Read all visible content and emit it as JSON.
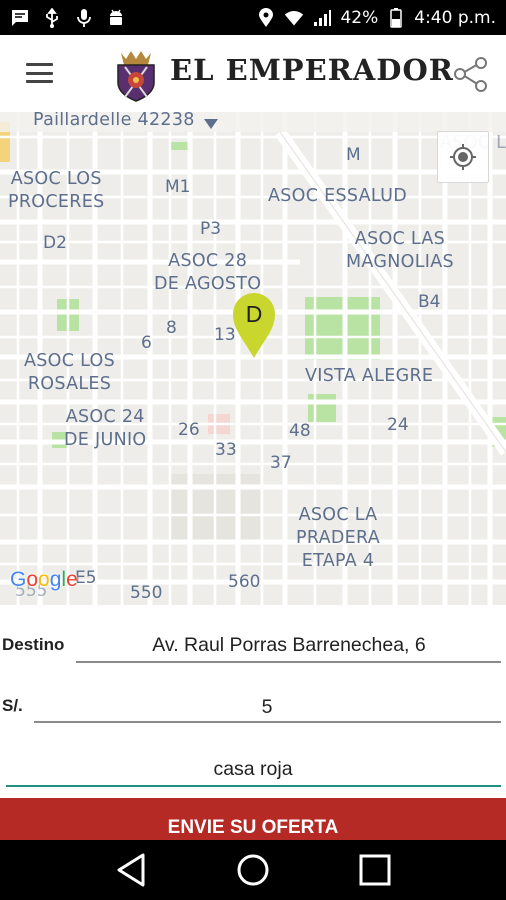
{
  "status_bar": {
    "battery": "42%",
    "time": "4:40 p.m.",
    "left_icons": [
      "message-icon",
      "usb-icon",
      "microphone-icon",
      "android-icon"
    ],
    "right_icons": [
      "location-icon",
      "wifi-icon",
      "signal-icon",
      "battery-icon"
    ]
  },
  "header": {
    "title": "EL EMPERADOR",
    "menu_icon": "hamburger-menu-icon",
    "share_icon": "share-icon"
  },
  "map": {
    "top_label": "Paillardelle 42238",
    "corner_label": "ASOC L SIE",
    "areas": [
      "ASOC LOS\nPROCERES",
      "ASOC ESSALUD",
      "ASOC LAS\nMAGNOLIAS",
      "ASOC 28\nDE AGOSTO",
      "ASOC LOS\nROSALES",
      "VISTA ALEGRE",
      "ASOC 24\nDE JUNIO",
      "ASOC LA\nPRADERA\nETAPA 4"
    ],
    "block_codes": [
      "M",
      "M1",
      "P3",
      "D2",
      "B4",
      "8",
      "13",
      "6",
      "26",
      "48",
      "24",
      "33",
      "37",
      "550",
      "560",
      "E5",
      "555"
    ],
    "pin_letter": "D",
    "pin_color": "#c8d62e",
    "watermark": "Google"
  },
  "form": {
    "destination_label": "Destino",
    "destination_value": "Av. Raul Porras Barrenechea, 6",
    "price_label": "S/.",
    "price_value": "5",
    "reference_value": "casa roja",
    "submit_label": "ENVIE SU OFERTA"
  },
  "nav": [
    "back-icon",
    "home-icon",
    "recents-icon"
  ],
  "colors": {
    "submit": "#b52a25",
    "active_underline": "#1f8e83",
    "map_text": "#5d6f8c",
    "park": "#b8e3a3"
  }
}
